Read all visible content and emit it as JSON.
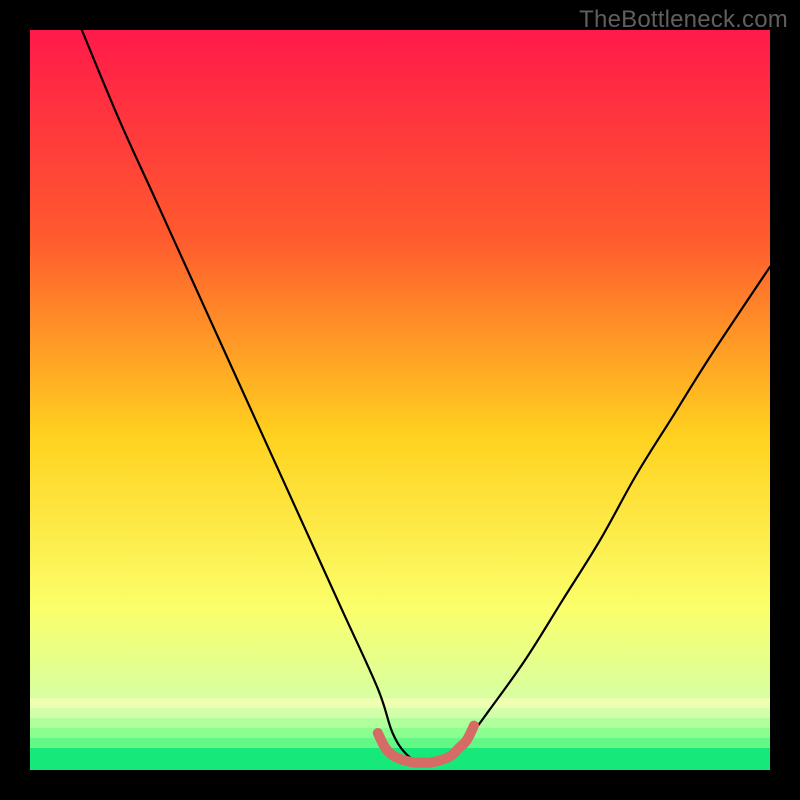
{
  "watermark": "TheBottleneck.com",
  "colors": {
    "frame": "#000000",
    "curve": "#000000",
    "accent": "#d66a64",
    "good": "#17e87a",
    "gradient_top": "#ff1a4a",
    "gradient_mid1": "#ff6e2a",
    "gradient_mid2": "#ffd21f",
    "gradient_mid3": "#f9ff7a",
    "gradient_bottom": "#17e87a"
  },
  "chart_data": {
    "type": "line",
    "title": "",
    "xlabel": "",
    "ylabel": "",
    "xlim": [
      0,
      100
    ],
    "ylim": [
      0,
      100
    ],
    "series": [
      {
        "name": "bottleneck-curve",
        "x": [
          7,
          12,
          17,
          22,
          27,
          32,
          37,
          42,
          47,
          49,
          51,
          53,
          55,
          57,
          59,
          62,
          67,
          72,
          77,
          82,
          87,
          92,
          100
        ],
        "y": [
          100,
          88,
          77,
          66,
          55,
          44,
          33,
          22,
          11,
          5,
          2,
          1,
          1,
          2,
          4,
          8,
          15,
          23,
          31,
          40,
          48,
          56,
          68
        ]
      },
      {
        "name": "optimal-band",
        "x": [
          47,
          48,
          49,
          50,
          51,
          52,
          53,
          54,
          55,
          56,
          57,
          58,
          59,
          60
        ],
        "y": [
          5,
          3,
          2,
          1.5,
          1.2,
          1,
          1,
          1,
          1.2,
          1.5,
          2,
          3,
          4,
          6
        ]
      }
    ],
    "annotations": []
  }
}
